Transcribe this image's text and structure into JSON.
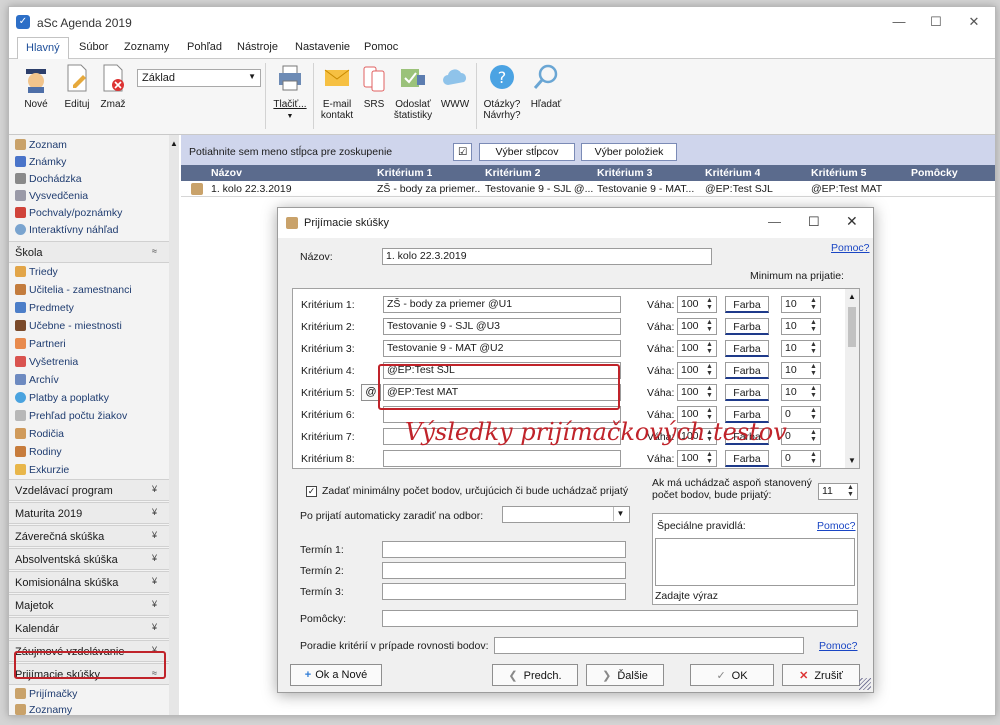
{
  "window": {
    "title": "aSc Agenda 2019"
  },
  "menu": [
    "Hlavný",
    "Súbor",
    "Zoznamy",
    "Pohľad",
    "Nástroje",
    "Nastavenie",
    "Pomoc"
  ],
  "ribbon": {
    "nove": "Nové",
    "edituj": "Edituj",
    "zmaz": "Zmaž",
    "combo": "Základ",
    "tlacit": "Tlačiť...",
    "email1": "E-mail",
    "email2": "kontakt",
    "srs": "SRS",
    "odoslat1": "Odoslať",
    "odoslat2": "štatistiky",
    "www": "WWW",
    "otazky1": "Otázky?",
    "otazky2": "Návrhy?",
    "hladat": "Hľadať"
  },
  "sidebar": {
    "top_items": [
      "Zoznam",
      "Známky",
      "Dochádzka",
      "Vysvedčenia",
      "Pochvaly/poznámky",
      "Interaktívny náhľad"
    ],
    "skola": "Škola",
    "skola_items": [
      "Triedy",
      "Učitelia - zamestnanci",
      "Predmety",
      "Učebne - miestnosti",
      "Partneri",
      "Vyšetrenia",
      "Archív",
      "Platby a poplatky",
      "Prehľad počtu žiakov",
      "Rodičia",
      "Rodiny",
      "Exkurzie"
    ],
    "sections": [
      "Vzdelávací program",
      "Maturita 2019",
      "Záverečná skúška",
      "Absolventská skúška",
      "Komisionálna skúška",
      "Majetok",
      "Kalendár",
      "Záujmové vzdelávanie"
    ],
    "prijimacie": "Prijímacie skúšky",
    "prijimacie_items": [
      "Prijímačky",
      "Zoznamy"
    ]
  },
  "grid": {
    "group_hint": "Potiahnite sem meno stĺpca pre zoskupenie",
    "btn_stlpce": "Výber stĺpcov",
    "btn_polozky": "Výber položiek",
    "headers": [
      "Názov",
      "Kritérium 1",
      "Kritérium 2",
      "Kritérium 3",
      "Kritérium 4",
      "Kritérium 5",
      "Pomôcky"
    ],
    "row": [
      "1. kolo 22.3.2019",
      "ZŠ - body za priemer...",
      "Testovanie 9 - SJL @...",
      "Testovanie 9 - MAT...",
      "@EP:Test SJL",
      "@EP:Test MAT",
      ""
    ]
  },
  "dialog": {
    "title": "Prijímacie skúšky",
    "pomoc": "Pomoc?",
    "nazov_label": "Názov:",
    "nazov_value": "1. kolo 22.3.2019",
    "minimum_label": "Minimum na prijatie:",
    "vaha_label": "Váha:",
    "farba_label": "Farba",
    "kriteria": [
      {
        "label": "Kritérium 1:",
        "value": "ZŠ - body za priemer @U1",
        "vaha": "100",
        "min": "10"
      },
      {
        "label": "Kritérium 2:",
        "value": "Testovanie 9 - SJL @U3",
        "vaha": "100",
        "min": "10"
      },
      {
        "label": "Kritérium 3:",
        "value": "Testovanie 9 - MAT @U2",
        "vaha": "100",
        "min": "10"
      },
      {
        "label": "Kritérium 4:",
        "value": "@EP:Test SJL",
        "vaha": "100",
        "min": "10"
      },
      {
        "label": "Kritérium 5:",
        "value": "@EP:Test MAT",
        "vaha": "100",
        "min": "10"
      },
      {
        "label": "Kritérium 6:",
        "value": "",
        "vaha": "100",
        "min": "0"
      },
      {
        "label": "Kritérium 7:",
        "value": "",
        "vaha": "100",
        "min": "0"
      },
      {
        "label": "Kritérium 8:",
        "value": "",
        "vaha": "100",
        "min": "0"
      }
    ],
    "at_button": "@",
    "checkbox_label": "Zadať minimálny počet bodov, určujúcich či bude uchádzač prijatý",
    "stanoveny_label1": "Ak má uchádzač aspoň stanovený",
    "stanoveny_label2": "počet bodov, bude prijatý:",
    "stanoveny_value": "11",
    "odbor_label": "Po prijatí automaticky zaradiť na odbor:",
    "pravidla_label": "Špeciálne pravidlá:",
    "zadajte_vyraz": "Zadajte výraz",
    "termin1": "Termín 1:",
    "termin2": "Termín 2:",
    "termin3": "Termín 3:",
    "pomocky_label": "Pomôcky:",
    "poradie_label": "Poradie kritérií v prípade rovnosti bodov:",
    "btn_ok_nove": "Ok a Nové",
    "btn_predch": "Predch.",
    "btn_dalsie": "Ďalšie",
    "btn_ok": "OK",
    "btn_zrusit": "Zrušiť"
  },
  "annotation": "Výsledky prijímačkových testov",
  "colors": {
    "accent": "#c0232a",
    "grid_header": "#5b6b8d",
    "grid_toolbar": "#cfd5ec",
    "link": "#1a46c4"
  }
}
